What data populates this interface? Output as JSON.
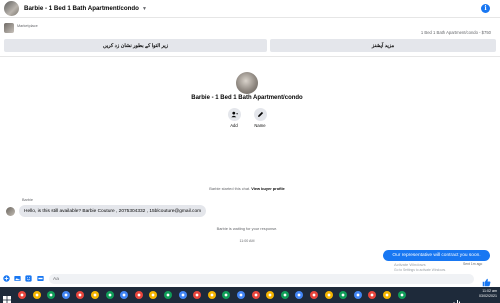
{
  "header": {
    "title": "Barbie - 1 Bed 1 Bath Apartment/condo",
    "info_glyph": "i"
  },
  "marketplace": {
    "label": "Marketplace",
    "listing_summary": "1 Bed 1 Bath Apartment/condo - $750",
    "button_left": "زیر التوا کے بطور نشان زد کریں",
    "button_right": "مزید آپشنز"
  },
  "profile": {
    "name": "Barbie - 1 Bed 1 Bath Apartment/condo",
    "actions": [
      {
        "label": "Add",
        "icon": "add-person-icon"
      },
      {
        "label": "Name",
        "icon": "pencil-icon"
      }
    ]
  },
  "conversation": {
    "started_text": "Barbie started this chat.",
    "view_profile_link": "View buyer profile",
    "sender_name": "Barbie",
    "incoming_message": "Hello, is this still available? Barbie Couture , 2075304332 , 15blcouture@gmail.com",
    "waiting_text": "Barbie is waiting for your response.",
    "time_divider": "11:00 AM",
    "outgoing_message": "Our representative will contract you soon.",
    "sent_status": "Sent 1m ago"
  },
  "watermark": {
    "line1": "Activate Windows",
    "line2": "Go to Settings to activate Windows."
  },
  "composer": {
    "placeholder": "Aa",
    "icons": [
      "plus-circle-icon",
      "image-icon",
      "sticker-icon",
      "gif-icon"
    ]
  },
  "taskbar": {
    "time": "11:02 am",
    "date": "03/02/2021",
    "app_colors": [
      "#e8453c",
      "#f4b400",
      "#0f9d58",
      "#4285f4",
      "#e8453c",
      "#f4b400",
      "#0f9d58",
      "#4285f4",
      "#e8453c",
      "#f4b400",
      "#0f9d58",
      "#4285f4",
      "#e8453c",
      "#f4b400",
      "#0f9d58",
      "#4285f4",
      "#e8453c",
      "#f4b400",
      "#0f9d58",
      "#4285f4",
      "#e8453c",
      "#f4b400",
      "#0f9d58",
      "#4285f4",
      "#e8453c",
      "#f4b400",
      "#0f9d58"
    ]
  },
  "colors": {
    "accent": "#1877f2",
    "bubble_in": "#e4e6eb",
    "taskbar": "#1e2a3a"
  }
}
